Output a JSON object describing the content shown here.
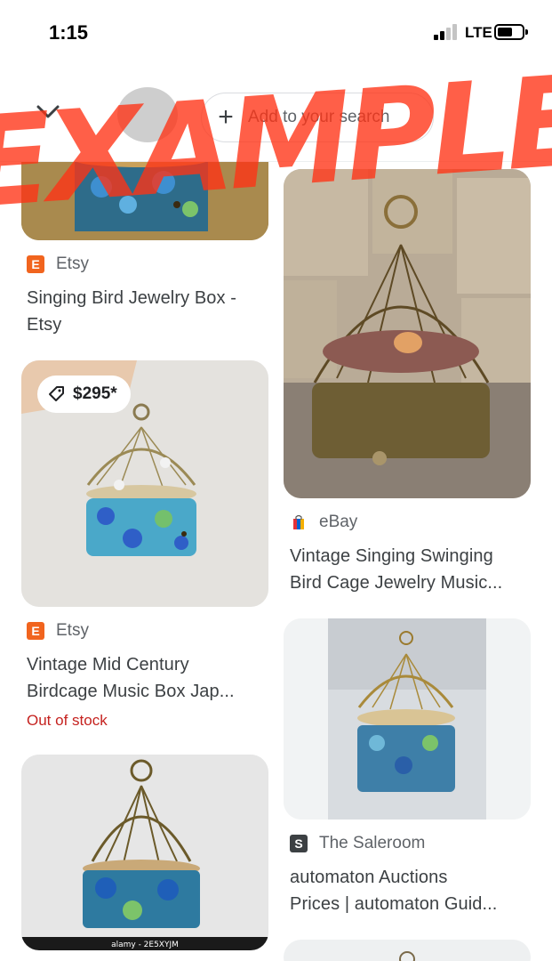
{
  "status_bar": {
    "time": "1:15",
    "network": "LTE",
    "battery_level": 0.6
  },
  "search": {
    "add_chip_label": "Add to your search"
  },
  "watermark": {
    "text": "EXAMPLE"
  },
  "results": [
    {
      "source": "Etsy",
      "source_icon_letter": "E",
      "source_color": "#f1641e",
      "title_lines": [
        "Singing Bird Jewelry Box -",
        "Etsy"
      ]
    },
    {
      "source": "Etsy",
      "source_icon_letter": "E",
      "source_color": "#f1641e",
      "price": "$295*",
      "title_lines": [
        "Vintage Mid Century",
        "Birdcage Music Box Jap..."
      ],
      "stock": "Out of stock"
    },
    {
      "source": "eBay",
      "source_icon_letter": "e",
      "source_color": "#e53238",
      "title_lines": [
        "Vintage Singing Swinging",
        "Bird Cage Jewelry Music..."
      ]
    },
    {
      "source": "The Saleroom",
      "source_icon_letter": "S",
      "source_color": "#3c4043",
      "title_lines": [
        "automaton Auctions",
        "Prices | automaton Guid..."
      ]
    },
    {
      "image_caption": "alamy - 2E5XYJM"
    }
  ],
  "colors": {
    "accent_red": "#c5221f",
    "chip_border": "#dadce0",
    "watermark": "#ff3214"
  }
}
